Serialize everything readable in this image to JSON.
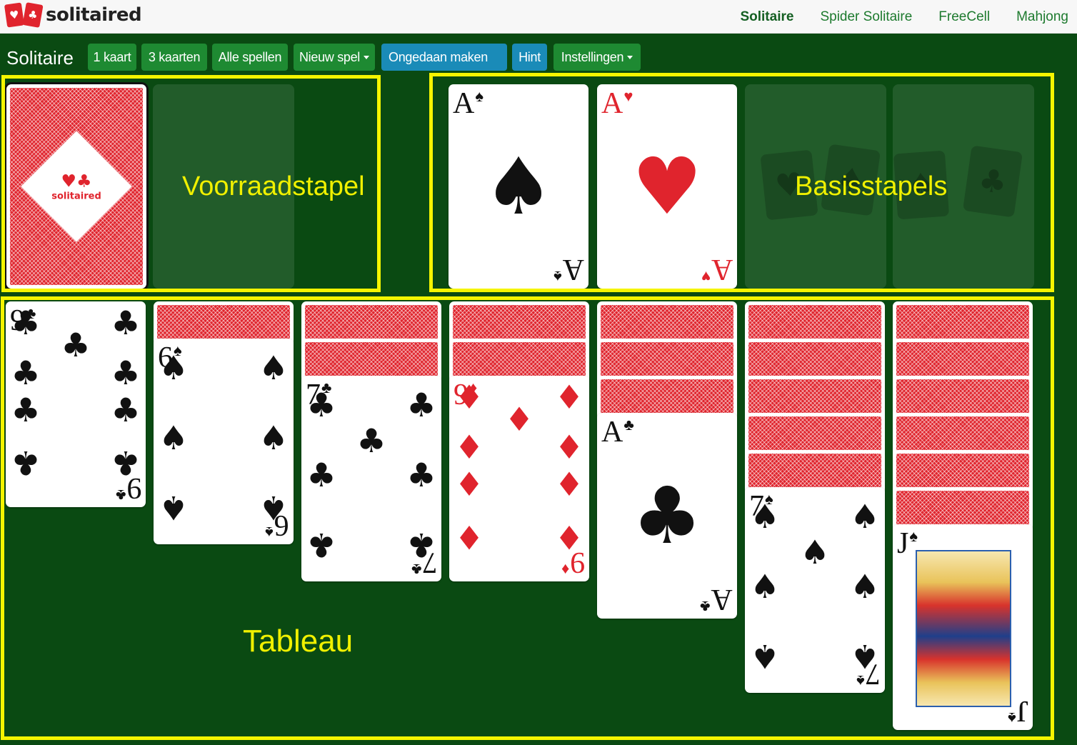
{
  "logo": {
    "text": "solitaired",
    "icon_suits": [
      "♥",
      "♣"
    ]
  },
  "nav": {
    "items": [
      {
        "label": "Solitaire",
        "active": true
      },
      {
        "label": "Spider Solitaire",
        "active": false
      },
      {
        "label": "FreeCell",
        "active": false
      },
      {
        "label": "Mahjong",
        "active": false
      }
    ]
  },
  "toolbar": {
    "title": "Solitaire",
    "one_card": "1 kaart",
    "three_cards": "3 kaarten",
    "all_games": "Alle spellen",
    "new_game": "Nieuw spel",
    "undo": "Ongedaan maken",
    "hint": "Hint",
    "settings": "Instellingen"
  },
  "labels": {
    "stock": "Voorraadstapel",
    "foundations": "Basisstapels",
    "tableau": "Tableau"
  },
  "stock": {
    "logo_text": "solitaired",
    "logo_suits": "♥♣"
  },
  "foundations": [
    {
      "rank": "A",
      "suit": "♠",
      "color": "#111111"
    },
    {
      "rank": "A",
      "suit": "♥",
      "color": "#e0242d"
    },
    {
      "empty": true,
      "ghost_suits": [
        "♥",
        "♠"
      ]
    },
    {
      "empty": true,
      "ghost_suits": [
        "♠",
        "♣",
        "♦"
      ]
    }
  ],
  "tableau": [
    {
      "face_down": 0,
      "top": {
        "rank": "9",
        "suit": "♣",
        "color": "#111111"
      }
    },
    {
      "face_down": 1,
      "top": {
        "rank": "6",
        "suit": "♠",
        "color": "#111111"
      }
    },
    {
      "face_down": 2,
      "top": {
        "rank": "7",
        "suit": "♣",
        "color": "#111111"
      }
    },
    {
      "face_down": 2,
      "top": {
        "rank": "9",
        "suit": "♦",
        "color": "#e0242d"
      }
    },
    {
      "face_down": 3,
      "top": {
        "rank": "A",
        "suit": "♣",
        "color": "#111111"
      }
    },
    {
      "face_down": 5,
      "top": {
        "rank": "7",
        "suit": "♠",
        "color": "#111111"
      }
    },
    {
      "face_down": 6,
      "top": {
        "rank": "J",
        "suit": "♠",
        "color": "#111111"
      }
    }
  ],
  "colors": {
    "felt": "#0a4a12",
    "green_button": "#1e8a32",
    "blue_button": "#1a8bb8",
    "highlight": "#f5f500",
    "card_back": "#e0242d"
  }
}
